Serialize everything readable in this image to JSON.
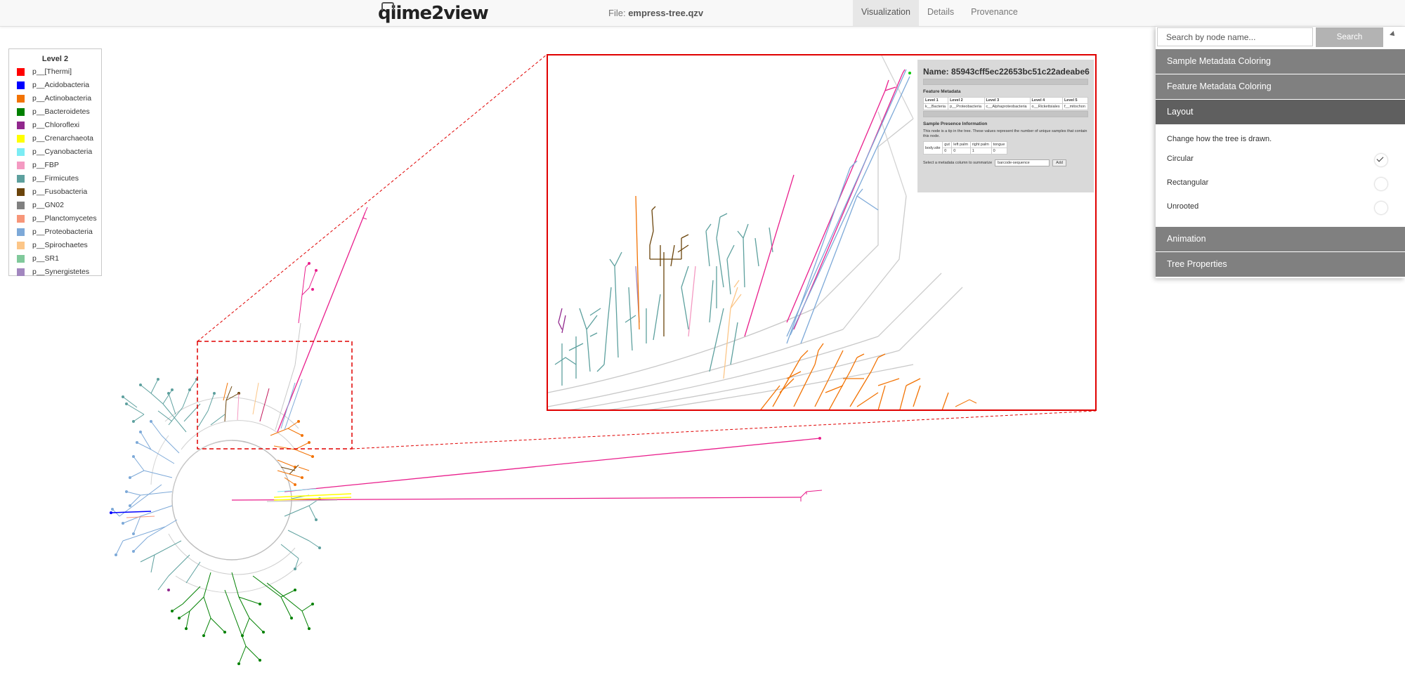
{
  "header": {
    "logo": "qiime2view",
    "file_label": "File:",
    "file_name": "empress-tree.qzv",
    "tabs": [
      {
        "label": "Visualization",
        "active": true
      },
      {
        "label": "Details",
        "active": false
      },
      {
        "label": "Provenance",
        "active": false
      }
    ]
  },
  "legend": {
    "title": "Level 2",
    "items": [
      {
        "label": "p__[Thermi]",
        "color": "#ff0000"
      },
      {
        "label": "p__Acidobacteria",
        "color": "#0000ff"
      },
      {
        "label": "p__Actinobacteria",
        "color": "#f27304"
      },
      {
        "label": "p__Bacteroidetes",
        "color": "#008000"
      },
      {
        "label": "p__Chloroflexi",
        "color": "#91278d"
      },
      {
        "label": "p__Crenarchaeota",
        "color": "#ffff00"
      },
      {
        "label": "p__Cyanobacteria",
        "color": "#7cecf4"
      },
      {
        "label": "p__FBP",
        "color": "#f49ac2"
      },
      {
        "label": "p__Firmicutes",
        "color": "#5da09e"
      },
      {
        "label": "p__Fusobacteria",
        "color": "#6b440b"
      },
      {
        "label": "p__GN02",
        "color": "#808080"
      },
      {
        "label": "p__Planctomycetes",
        "color": "#f79679"
      },
      {
        "label": "p__Proteobacteria",
        "color": "#7da9d8"
      },
      {
        "label": "p__Spirochaetes",
        "color": "#fcc688"
      },
      {
        "label": "p__SR1",
        "color": "#80c99b"
      },
      {
        "label": "p__Synergistetes",
        "color": "#a287bf"
      }
    ]
  },
  "popup": {
    "name": "Name: 85943cff5ec22653bc51c22adeabe6",
    "feature_metadata_title": "Feature Metadata",
    "fm_headers": [
      "Level 1",
      "Level 2",
      "Level 3",
      "Level 4",
      "Level 5"
    ],
    "fm_values": [
      "k__Bacteria",
      "p__Proteobacteria",
      "c__Alphaproteobacteria",
      "o__Rickettsiales",
      "f__mitochon"
    ],
    "sample_presence_title": "Sample Presence Information",
    "sample_presence_note": "This node is a tip in the tree. These values represent the number of unique samples that contain this node.",
    "presence_header": [
      "body.site",
      "gut",
      "left palm",
      "right palm",
      "tongue"
    ],
    "presence_values": [
      "",
      "0",
      "0",
      "1",
      "0"
    ],
    "select_label": "Select a metadata column to summarize",
    "select_value": "barcode-sequence",
    "add_label": "Add"
  },
  "panel": {
    "search_placeholder": "Search by node name...",
    "search_button": "Search",
    "sample_metadata": "Sample Metadata Coloring",
    "feature_metadata": "Feature Metadata Coloring",
    "layout": "Layout",
    "layout_desc": "Change how the tree is drawn.",
    "layouts": [
      {
        "label": "Circular",
        "selected": true
      },
      {
        "label": "Rectangular",
        "selected": false
      },
      {
        "label": "Unrooted",
        "selected": false
      }
    ],
    "animation": "Animation",
    "tree_properties": "Tree Properties"
  }
}
